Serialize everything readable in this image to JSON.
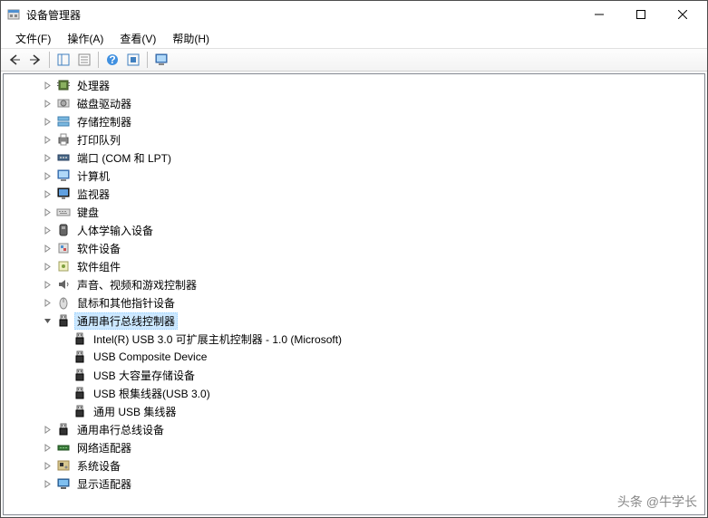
{
  "title": "设备管理器",
  "menus": {
    "file": "文件(F)",
    "action": "操作(A)",
    "view": "查看(V)",
    "help": "帮助(H)"
  },
  "tree": [
    {
      "label": "处理器",
      "icon": "cpu",
      "exp": "closed",
      "depth": 2
    },
    {
      "label": "磁盘驱动器",
      "icon": "disk",
      "exp": "closed",
      "depth": 2
    },
    {
      "label": "存储控制器",
      "icon": "storage",
      "exp": "closed",
      "depth": 2
    },
    {
      "label": "打印队列",
      "icon": "printer",
      "exp": "closed",
      "depth": 2
    },
    {
      "label": "端口 (COM 和 LPT)",
      "icon": "port",
      "exp": "closed",
      "depth": 2
    },
    {
      "label": "计算机",
      "icon": "computer",
      "exp": "closed",
      "depth": 2
    },
    {
      "label": "监视器",
      "icon": "monitor",
      "exp": "closed",
      "depth": 2
    },
    {
      "label": "键盘",
      "icon": "keyboard",
      "exp": "closed",
      "depth": 2
    },
    {
      "label": "人体学输入设备",
      "icon": "hid",
      "exp": "closed",
      "depth": 2
    },
    {
      "label": "软件设备",
      "icon": "software",
      "exp": "closed",
      "depth": 2
    },
    {
      "label": "软件组件",
      "icon": "component",
      "exp": "closed",
      "depth": 2
    },
    {
      "label": "声音、视频和游戏控制器",
      "icon": "sound",
      "exp": "closed",
      "depth": 2
    },
    {
      "label": "鼠标和其他指针设备",
      "icon": "mouse",
      "exp": "closed",
      "depth": 2
    },
    {
      "label": "通用串行总线控制器",
      "icon": "usb",
      "exp": "open",
      "depth": 2,
      "selected": true
    },
    {
      "label": "Intel(R) USB 3.0 可扩展主机控制器 - 1.0 (Microsoft)",
      "icon": "usb",
      "exp": "none",
      "depth": 3
    },
    {
      "label": "USB Composite Device",
      "icon": "usb",
      "exp": "none",
      "depth": 3
    },
    {
      "label": "USB 大容量存储设备",
      "icon": "usb",
      "exp": "none",
      "depth": 3
    },
    {
      "label": "USB 根集线器(USB 3.0)",
      "icon": "usb",
      "exp": "none",
      "depth": 3
    },
    {
      "label": "通用 USB 集线器",
      "icon": "usb",
      "exp": "none",
      "depth": 3
    },
    {
      "label": "通用串行总线设备",
      "icon": "usb",
      "exp": "closed",
      "depth": 2
    },
    {
      "label": "网络适配器",
      "icon": "network",
      "exp": "closed",
      "depth": 2
    },
    {
      "label": "系统设备",
      "icon": "system",
      "exp": "closed",
      "depth": 2
    },
    {
      "label": "显示适配器",
      "icon": "display",
      "exp": "closed",
      "depth": 2
    }
  ],
  "watermark": "头条 @牛学长"
}
